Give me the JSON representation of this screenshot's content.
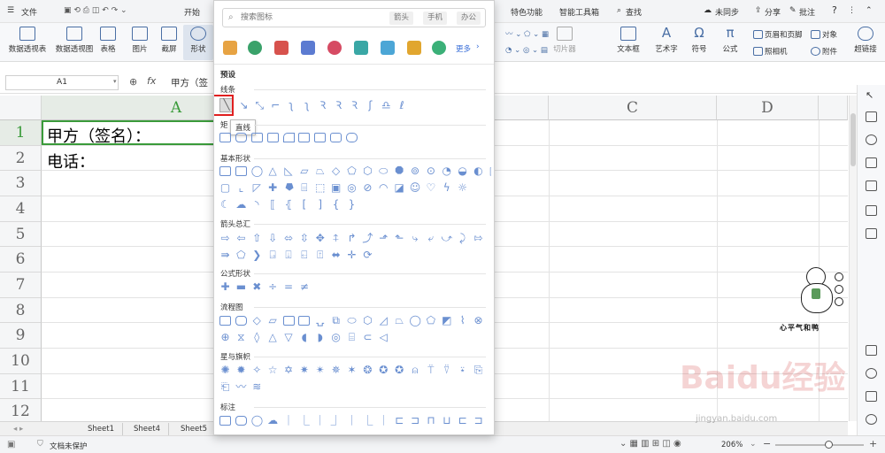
{
  "titlebar": {
    "menu": "文件",
    "start_tab": "开始",
    "tabs_right": [
      "特色功能",
      "智能工具箱"
    ],
    "search": "查找",
    "sync": "未同步",
    "share": "分享",
    "comment": "批注",
    "help": "?"
  },
  "ribbon": {
    "buttons": [
      "数据透视表",
      "数据透视图",
      "表格",
      "图片",
      "截屏",
      "形状"
    ],
    "right": {
      "slicer": "切片器",
      "textbox": "文本框",
      "art": "艺术字",
      "symbol": "符号",
      "formula": "公式",
      "header_footer": "页眉和页脚",
      "object": "对象",
      "camera": "照相机",
      "attachment": "附件",
      "hyperlink": "超链接"
    }
  },
  "formula_bar": {
    "cell": "A1",
    "fx": "fx",
    "content": "甲方（签"
  },
  "sheet": {
    "columns": [
      "A",
      "C",
      "D"
    ],
    "rows": [
      "1",
      "2",
      "3",
      "4",
      "5",
      "6",
      "7",
      "8",
      "9",
      "10",
      "11",
      "12"
    ],
    "cells": {
      "A1": "甲方（签名）：",
      "A2": "电话："
    }
  },
  "sheet_tabs": [
    "Sheet1",
    "Sheet4",
    "Sheet5"
  ],
  "status": {
    "protect": "文档未保护",
    "zoom": "206%"
  },
  "shape_popup": {
    "search_placeholder": "搜索图标",
    "chips": [
      "箭头",
      "手机",
      "办公"
    ],
    "more": "更多",
    "preset": "预设",
    "sections": [
      "线条",
      "矩",
      "基本形状",
      "箭头总汇",
      "公式形状",
      "流程图",
      "星与旗帜",
      "标注"
    ],
    "tooltip": "直线"
  },
  "sticker_caption": "心平气和鸭",
  "watermark": {
    "brand": "Baidu经验",
    "url": "jingyan.baidu.com"
  }
}
